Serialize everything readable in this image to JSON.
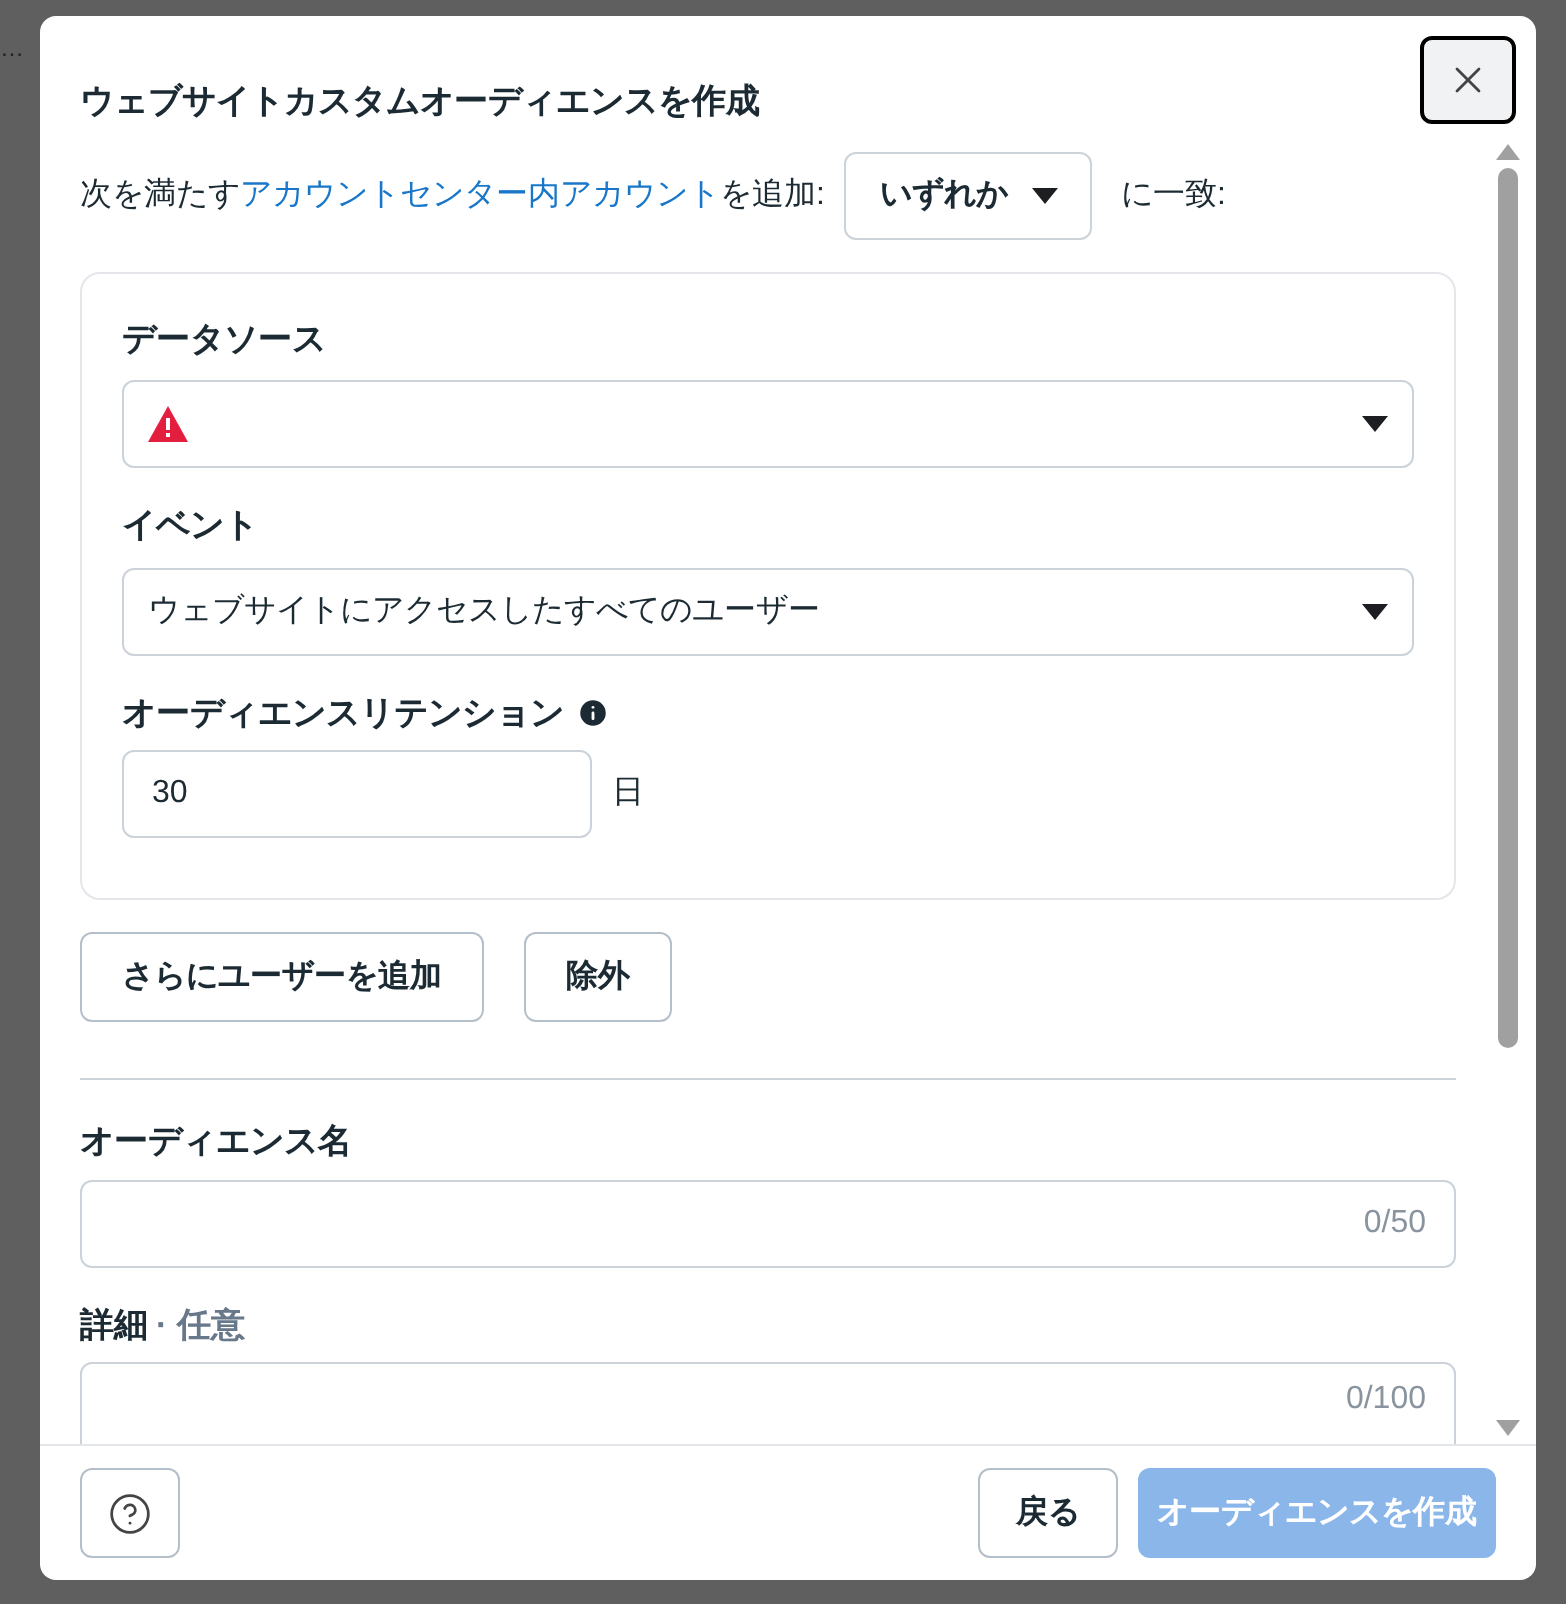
{
  "background": {
    "fragment": "…"
  },
  "dialog": {
    "title": "ウェブサイトカスタムオーディエンスを作成",
    "match_row": {
      "prefix": "次を満たす",
      "link": "アカウントセンター内アカウント",
      "suffix": "を追加:",
      "dropdown": "いずれか",
      "after": "に一致:"
    },
    "rule_fields": [
      {
        "kind": "select",
        "label": "データソース",
        "error": true
      },
      {
        "kind": "select",
        "label": "イベント",
        "value": "ウェブサイトにアクセスしたすべてのユーザー",
        "error": false
      },
      {
        "kind": "number",
        "label": "オーディエンスリテンション",
        "info": true,
        "value": "30",
        "unit": "日"
      }
    ],
    "rule_buttons": [
      "さらにユーザーを追加",
      "除外"
    ],
    "name_field": {
      "label": "オーディエンス名",
      "counter": "0/50"
    },
    "description_field": {
      "label": "詳細",
      "optional": "· 任意",
      "counter": "0/100"
    },
    "footer": {
      "back": "戻る",
      "create": {
        "label": "オーディエンスを作成",
        "disabled": true
      }
    }
  }
}
